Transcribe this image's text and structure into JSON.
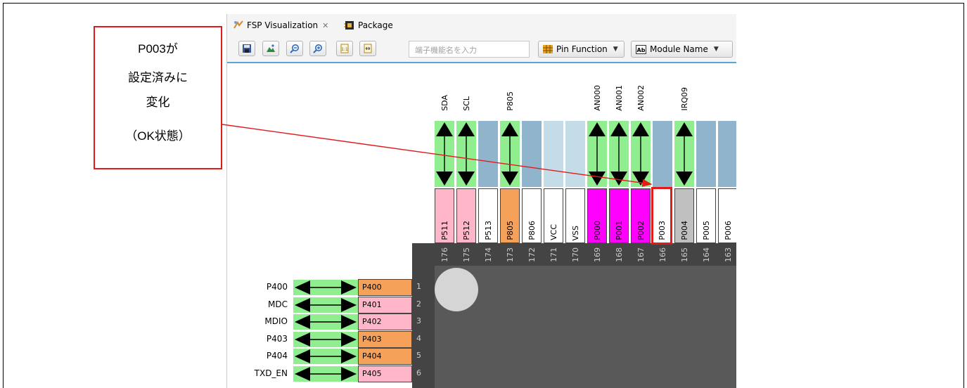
{
  "tabs": [
    {
      "label": "FSP Visualization",
      "active": true,
      "close_icon": "close-icon"
    },
    {
      "label": "Package",
      "active": false
    }
  ],
  "toolbar": {
    "buttons": [
      "save-icon",
      "mountain-icon",
      "zoom-out-icon",
      "zoom-in-icon",
      "fit-page-icon",
      "fit-width-icon"
    ],
    "search_placeholder": "端子機能名を入力",
    "dropdown1": "Pin Function",
    "dropdown2": "Module Name"
  },
  "top_pins": [
    {
      "num": "176",
      "name": "P511",
      "signal": "SDA",
      "color": "#ffb6c8",
      "conn": "bidir"
    },
    {
      "num": "175",
      "name": "P512",
      "signal": "SCL",
      "color": "#ffb6c8",
      "conn": "bidir"
    },
    {
      "num": "174",
      "name": "P513",
      "signal": "",
      "color": "#ffffff",
      "conn": "none"
    },
    {
      "num": "173",
      "name": "P805",
      "signal": "P805",
      "color": "#f5a15a",
      "conn": "bidir"
    },
    {
      "num": "172",
      "name": "P806",
      "signal": "",
      "color": "#ffffff",
      "conn": "none"
    },
    {
      "num": "171",
      "name": "VCC",
      "signal": "",
      "color": "#ffffff",
      "conn": "light"
    },
    {
      "num": "170",
      "name": "VSS",
      "signal": "",
      "color": "#ffffff",
      "conn": "light"
    },
    {
      "num": "169",
      "name": "P000",
      "signal": "AN000",
      "color": "#ff00ff",
      "conn": "bidir"
    },
    {
      "num": "168",
      "name": "P001",
      "signal": "AN001",
      "color": "#ff00ff",
      "conn": "bidir"
    },
    {
      "num": "167",
      "name": "P002",
      "signal": "AN002",
      "color": "#ff00ff",
      "conn": "bidir"
    },
    {
      "num": "166",
      "name": "P003",
      "signal": "",
      "color": "#ffffff",
      "conn": "none",
      "highlight": true
    },
    {
      "num": "165",
      "name": "P004",
      "signal": "IRQ09",
      "color": "#c0c0c0",
      "conn": "bidir"
    },
    {
      "num": "164",
      "name": "P005",
      "signal": "",
      "color": "#ffffff",
      "conn": "none"
    },
    {
      "num": "163",
      "name": "P006",
      "signal": "",
      "color": "#ffffff",
      "conn": "none"
    }
  ],
  "left_pins": [
    {
      "num": "1",
      "name": "P400",
      "signal": "P400",
      "color": "#f5a15a"
    },
    {
      "num": "2",
      "name": "P401",
      "signal": "MDC",
      "color": "#ffb6c8"
    },
    {
      "num": "3",
      "name": "P402",
      "signal": "MDIO",
      "color": "#ffb6c8"
    },
    {
      "num": "4",
      "name": "P403",
      "signal": "P403",
      "color": "#f5a15a"
    },
    {
      "num": "5",
      "name": "P404",
      "signal": "P404",
      "color": "#f5a15a"
    },
    {
      "num": "6",
      "name": "P405",
      "signal": "TXD_EN",
      "color": "#ffb6c8"
    }
  ],
  "callout": {
    "line1": "P003が",
    "line2": "設定済みに",
    "line3": "変化",
    "line4": "（OK状態）"
  },
  "colors": {
    "callout_border": "#e31a1a",
    "connector_green": "#90ee90",
    "connector_blue": "#8fb4cc",
    "connector_light": "#c4dbe8",
    "chip_body": "#444444"
  }
}
